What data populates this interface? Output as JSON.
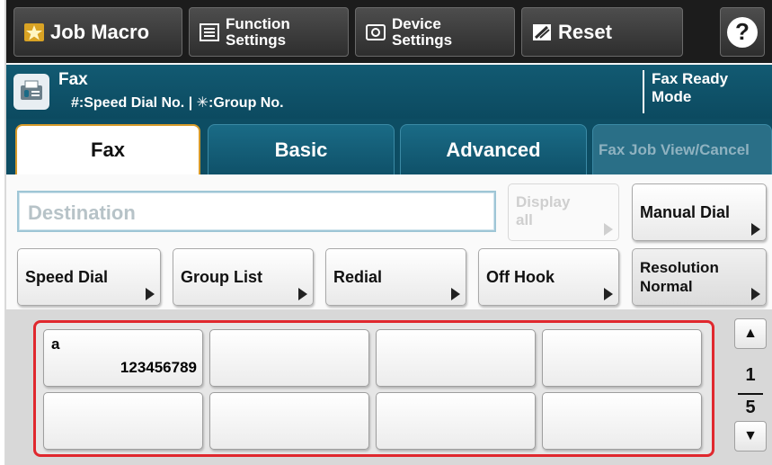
{
  "topbar": {
    "job_macro": "Job Macro",
    "function_settings": "Function\nSettings",
    "device_settings": "Device\nSettings",
    "reset": "Reset",
    "help": "?"
  },
  "status": {
    "title": "Fax",
    "subtitle": "#:Speed Dial No. | ✳:Group No.",
    "mode": "Fax Ready\nMode"
  },
  "tabs": [
    {
      "label": "Fax",
      "active": true
    },
    {
      "label": "Basic",
      "active": false
    },
    {
      "label": "Advanced",
      "active": false
    },
    {
      "label": "Fax Job View/Cancel",
      "active": false
    }
  ],
  "destination": {
    "placeholder": "Destination"
  },
  "buttons": {
    "display_all": "Display\nall",
    "manual_dial": "Manual Dial",
    "speed_dial": "Speed Dial",
    "group_list": "Group List",
    "redial": "Redial",
    "off_hook": "Off Hook",
    "resolution": "Resolution\nNormal"
  },
  "speed_dial_entries": [
    {
      "name": "a",
      "number": "123456789"
    },
    {
      "name": "",
      "number": ""
    },
    {
      "name": "",
      "number": ""
    },
    {
      "name": "",
      "number": ""
    },
    {
      "name": "",
      "number": ""
    },
    {
      "name": "",
      "number": ""
    },
    {
      "name": "",
      "number": ""
    },
    {
      "name": "",
      "number": ""
    }
  ],
  "pager": {
    "current": "1",
    "total": "5"
  },
  "colors": {
    "highlight": "#e0282e",
    "active_tab_border": "#d69a2a",
    "status_bar": "#0c4a60"
  }
}
